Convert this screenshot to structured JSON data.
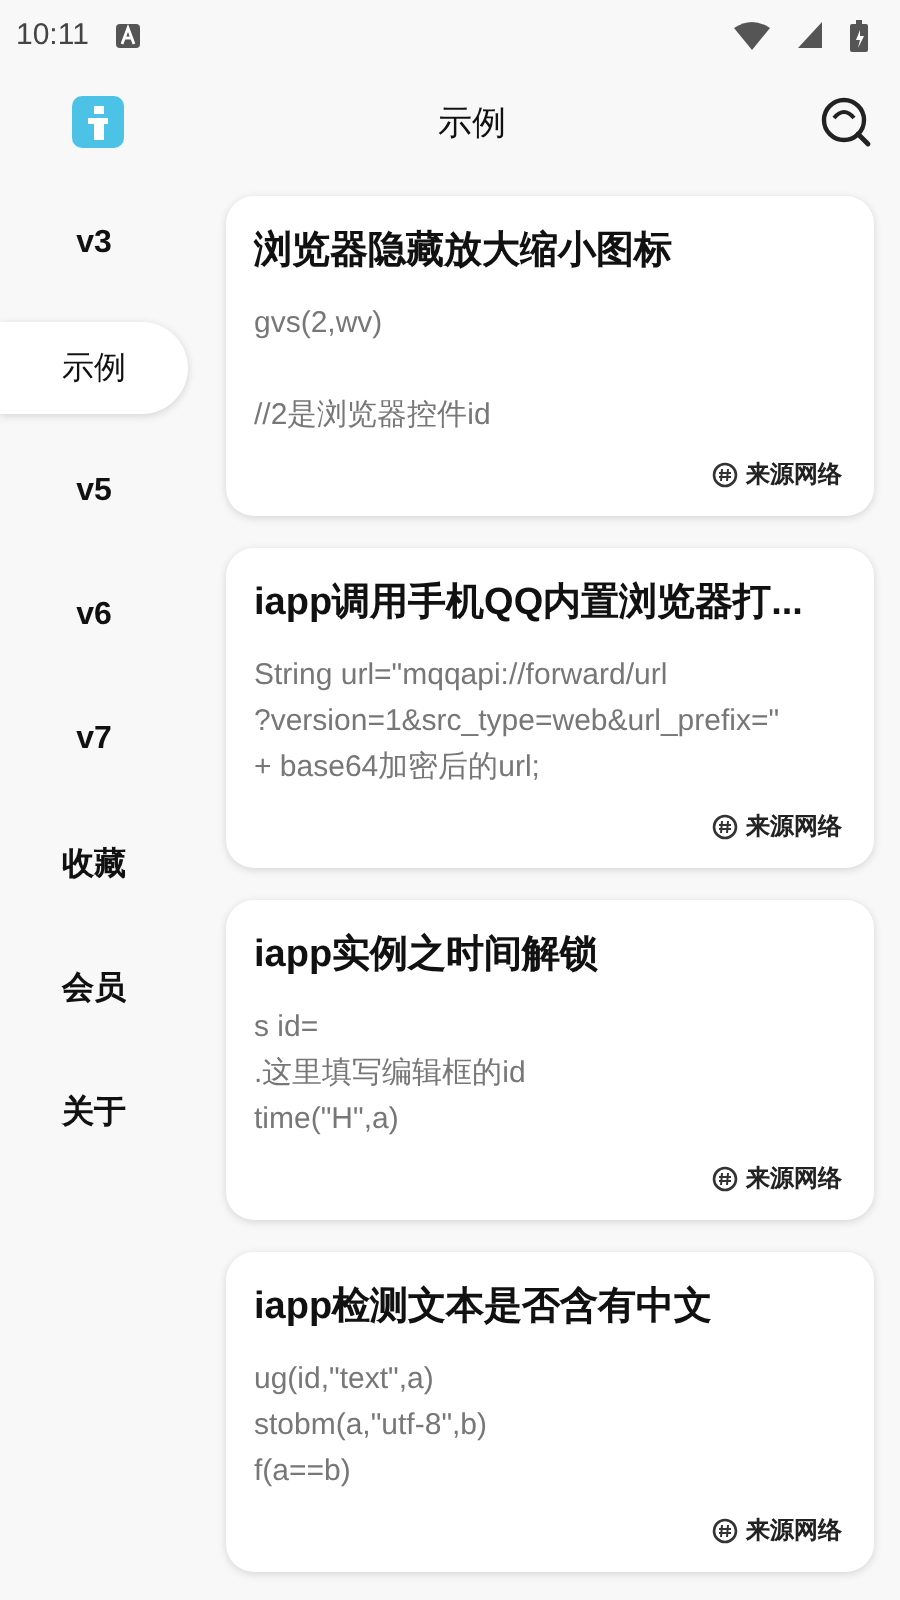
{
  "status_bar": {
    "time": "10:11"
  },
  "header": {
    "title": "示例"
  },
  "sidebar": {
    "items": [
      {
        "label": "v3",
        "selected": false
      },
      {
        "label": "示例",
        "selected": true
      },
      {
        "label": "v5",
        "selected": false
      },
      {
        "label": "v6",
        "selected": false
      },
      {
        "label": "v7",
        "selected": false
      },
      {
        "label": "收藏",
        "selected": false
      },
      {
        "label": "会员",
        "selected": false
      },
      {
        "label": "关于",
        "selected": false
      }
    ]
  },
  "cards": [
    {
      "title": "浏览器隐藏放大缩小图标",
      "paragraphs": [
        [
          "gvs(2,wv)"
        ],
        [
          "//2是浏览器控件id"
        ]
      ],
      "source": "来源网络"
    },
    {
      "title": "iapp调用手机QQ内置浏览器打...",
      "paragraphs": [
        [
          "String url=\"mqqapi://forward/url",
          "?version=1&src_type=web&url_prefix=\"",
          "+ base64加密后的url;"
        ]
      ],
      "source": "来源网络"
    },
    {
      "title": "iapp实例之时间解锁",
      "paragraphs": [
        [
          "s id=",
          ".这里填写编辑框的id",
          "time(\"H\",a)"
        ]
      ],
      "source": "来源网络"
    },
    {
      "title": "iapp检测文本是否含有中文",
      "paragraphs": [
        [
          "ug(id,\"text\",a)",
          "stobm(a,\"utf-8\",b)",
          "f(a==b)"
        ]
      ],
      "source": "来源网络"
    }
  ]
}
